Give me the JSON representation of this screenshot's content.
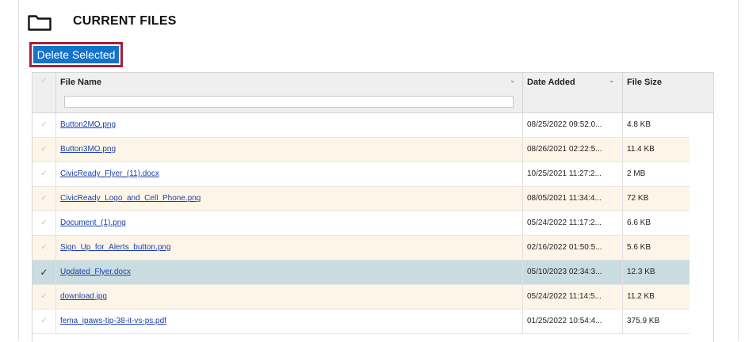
{
  "title": "CURRENT FILES",
  "delete_button": "Delete Selected",
  "columns": {
    "select_all_icon": "check-icon",
    "file_name": "File Name",
    "date_added": "Date Added",
    "file_size": "File Size"
  },
  "filter": {
    "file_name_value": "",
    "placeholder": ""
  },
  "rows": [
    {
      "name": "Button2MO.png",
      "date": "08/25/2022 09:52:0...",
      "size": "4.8 KB",
      "selected": false
    },
    {
      "name": "Button3MO.png",
      "date": "08/26/2021 02:22:5...",
      "size": "11.4 KB",
      "selected": false
    },
    {
      "name": "CivicReady_Flyer_(11).docx",
      "date": "10/25/2021 11:27:2...",
      "size": "2 MB",
      "selected": false
    },
    {
      "name": "CivicReady_Logo_and_Cell_Phone.png",
      "date": "08/05/2021 11:34:4...",
      "size": "72 KB",
      "selected": false
    },
    {
      "name": "Document_(1).png",
      "date": "05/24/2022 11:17:2...",
      "size": "6.6 KB",
      "selected": false
    },
    {
      "name": "Sign_Up_for_Alerts_button.png",
      "date": "02/16/2022 01:50:5...",
      "size": "5.6 KB",
      "selected": false
    },
    {
      "name": "Updated_Flyer.docx",
      "date": "05/10/2023 02:34:3...",
      "size": "12.3 KB",
      "selected": true
    },
    {
      "name": "download.jpg",
      "date": "05/24/2022 11:14:5...",
      "size": "11.2 KB",
      "selected": false
    },
    {
      "name": "fema_ipaws-tip-38-it-vs-ps.pdf",
      "date": "01/25/2022 10:54:4...",
      "size": "375.9 KB",
      "selected": false
    }
  ]
}
